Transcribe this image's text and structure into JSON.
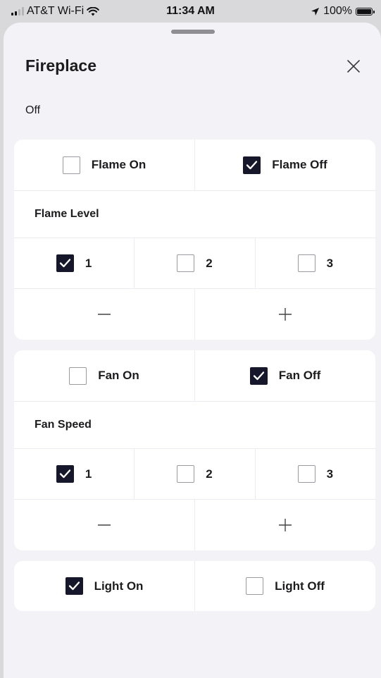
{
  "status_bar": {
    "carrier": "AT&T Wi-Fi",
    "time": "11:34 AM",
    "battery": "100%",
    "icons": [
      "signal-icon",
      "wifi-icon",
      "location-arrow-icon",
      "battery-icon"
    ]
  },
  "sheet": {
    "title": "Fireplace",
    "status": "Off",
    "close_icon": "close-icon"
  },
  "flame": {
    "on_label": "Flame On",
    "on_checked": false,
    "off_label": "Flame Off",
    "off_checked": true,
    "level_label": "Flame Level",
    "levels": [
      {
        "label": "1",
        "checked": true
      },
      {
        "label": "2",
        "checked": false
      },
      {
        "label": "3",
        "checked": false
      }
    ],
    "decrease_icon": "minus-icon",
    "increase_icon": "plus-icon"
  },
  "fan": {
    "on_label": "Fan On",
    "on_checked": false,
    "off_label": "Fan Off",
    "off_checked": true,
    "speed_label": "Fan Speed",
    "speeds": [
      {
        "label": "1",
        "checked": true
      },
      {
        "label": "2",
        "checked": false
      },
      {
        "label": "3",
        "checked": false
      }
    ],
    "decrease_icon": "minus-icon",
    "increase_icon": "plus-icon"
  },
  "light": {
    "on_label": "Light On",
    "on_checked": true,
    "off_label": "Light Off",
    "off_checked": false
  },
  "colors": {
    "checkbox_checked": "#16172b",
    "card_background": "#ffffff",
    "sheet_background": "#f2f2f7"
  }
}
